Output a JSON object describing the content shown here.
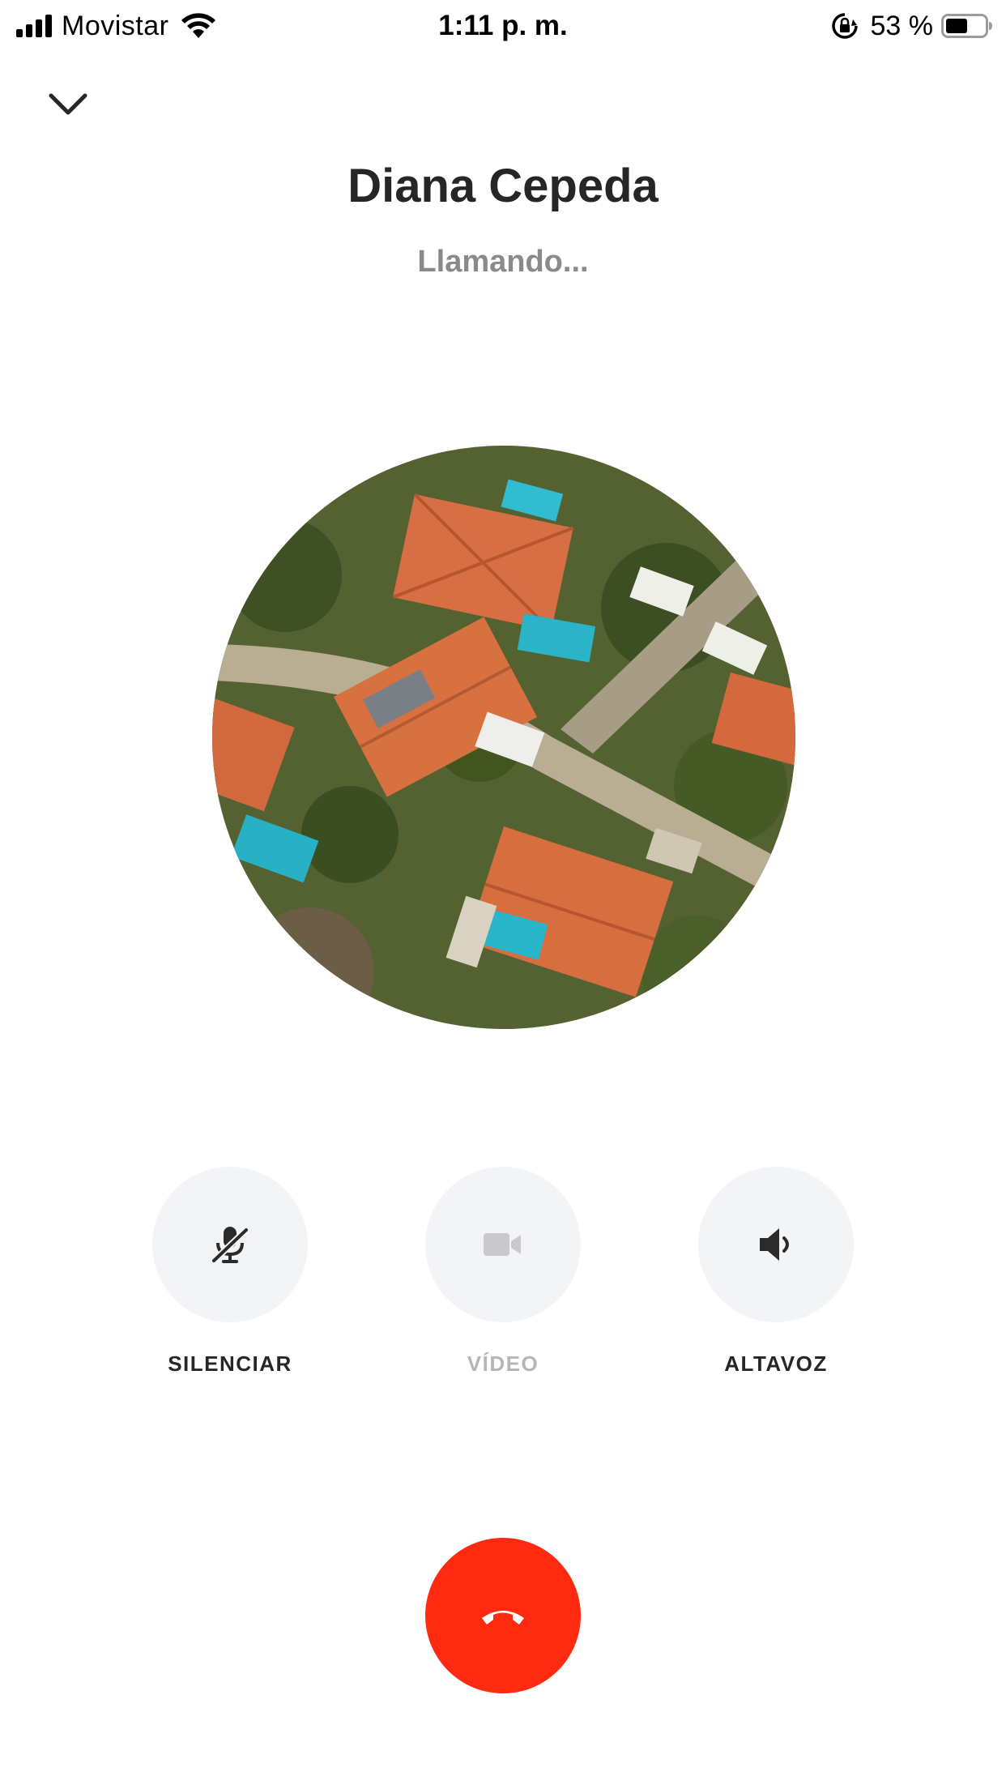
{
  "status_bar": {
    "carrier": "Movistar",
    "time": "1:11 p. m.",
    "battery_percent": "53 %",
    "signal_icon": "signal-bars-icon",
    "wifi_icon": "wifi-icon",
    "orientation_lock_icon": "orientation-lock-icon",
    "battery_icon": "battery-icon"
  },
  "header": {
    "collapse_icon": "chevron-down-icon",
    "callee_name": "Diana Cepeda",
    "call_status": "Llamando..."
  },
  "avatar": {
    "description_icon": "profile-photo"
  },
  "controls": [
    {
      "label": "SILENCIAR",
      "icon": "mic-off-icon",
      "enabled": true
    },
    {
      "label": "VÍDEO",
      "icon": "video-camera-icon",
      "enabled": false
    },
    {
      "label": "ALTAVOZ",
      "icon": "speaker-icon",
      "enabled": true
    }
  ],
  "end_call": {
    "icon": "hang-up-phone-icon",
    "color": "#ff2a10"
  },
  "colors": {
    "button_bg": "#f3f4f6",
    "text_primary": "#262626",
    "text_secondary": "#8a8a8a",
    "text_disabled": "#b6b6b6"
  }
}
